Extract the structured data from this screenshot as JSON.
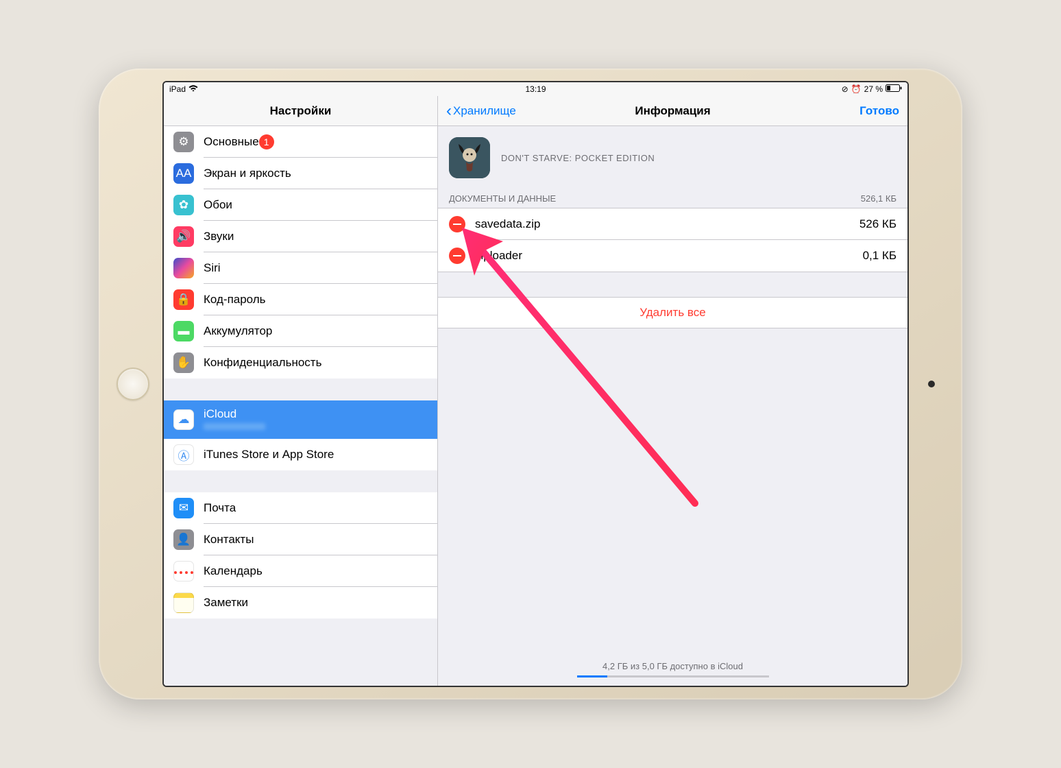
{
  "statusBar": {
    "device": "iPad",
    "time": "13:19",
    "battery": "27 %"
  },
  "sidebar": {
    "title": "Настройки",
    "groups": [
      {
        "items": [
          {
            "id": "general",
            "label": "Основные",
            "badge": "1",
            "iconClass": "ic-general",
            "glyph": "⚙"
          },
          {
            "id": "display",
            "label": "Экран и яркость",
            "iconClass": "ic-display",
            "glyph": "AA"
          },
          {
            "id": "wallpaper",
            "label": "Обои",
            "iconClass": "ic-wallpaper",
            "glyph": "✿"
          },
          {
            "id": "sounds",
            "label": "Звуки",
            "iconClass": "ic-sounds",
            "glyph": "🔊"
          },
          {
            "id": "siri",
            "label": "Siri",
            "iconClass": "ic-siri",
            "glyph": ""
          },
          {
            "id": "passcode",
            "label": "Код-пароль",
            "iconClass": "ic-passcode",
            "glyph": "🔒"
          },
          {
            "id": "battery",
            "label": "Аккумулятор",
            "iconClass": "ic-battery",
            "glyph": "▬"
          },
          {
            "id": "privacy",
            "label": "Конфиденциальность",
            "iconClass": "ic-privacy",
            "glyph": "✋"
          }
        ]
      },
      {
        "items": [
          {
            "id": "icloud",
            "label": "iCloud",
            "sublabel": "",
            "selected": true,
            "iconClass": "ic-icloud",
            "glyph": "☁",
            "tall": true
          },
          {
            "id": "itunes",
            "label": "iTunes Store и App Store",
            "iconClass": "ic-itunes",
            "glyph": "Ⓐ"
          }
        ]
      },
      {
        "items": [
          {
            "id": "mail",
            "label": "Почта",
            "iconClass": "ic-mail",
            "glyph": "✉"
          },
          {
            "id": "contacts",
            "label": "Контакты",
            "iconClass": "ic-contacts",
            "glyph": "👤"
          },
          {
            "id": "calendar",
            "label": "Календарь",
            "iconClass": "ic-calendar",
            "glyph": ""
          },
          {
            "id": "notes",
            "label": "Заметки",
            "iconClass": "ic-notes",
            "glyph": ""
          }
        ]
      }
    ]
  },
  "detail": {
    "backLabel": "Хранилище",
    "title": "Информация",
    "doneLabel": "Готово",
    "appName": "DON'T STARVE: POCKET EDITION",
    "sectionTitle": "ДОКУМЕНТЫ И ДАННЫЕ",
    "sectionSize": "526,1 КБ",
    "documents": [
      {
        "name": "savedata.zip",
        "size": "526 КБ"
      },
      {
        "name": "ziploader",
        "size": "0,1 КБ"
      }
    ],
    "deleteAll": "Удалить все",
    "storageText": "4,2 ГБ из 5,0 ГБ доступно в iCloud"
  }
}
